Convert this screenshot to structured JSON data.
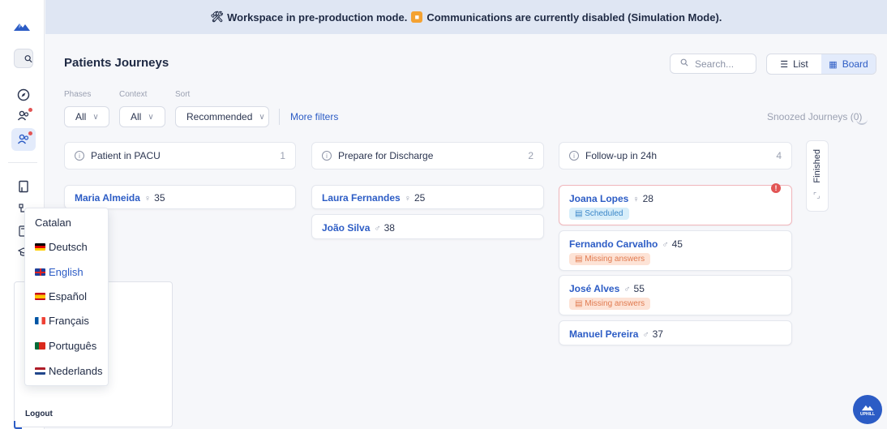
{
  "banner": {
    "prefix_icon": "✖",
    "text_before": "Workspace in pre-production mode.",
    "text_after": "Communications are currently disabled (Simulation Mode).",
    "warning_color": "#f4a232"
  },
  "header": {
    "title": "Patients Journeys",
    "search_placeholder": "Search...",
    "view_list": "List",
    "view_board": "Board"
  },
  "filters": {
    "phases_label": "Phases",
    "phases_value": "All",
    "context_label": "Context",
    "context_value": "All",
    "sort_label": "Sort",
    "sort_value": "Recommended",
    "more_filters": "More filters",
    "snoozed": "Snoozed Journeys (0)"
  },
  "columns": [
    {
      "title": "Patient in PACU",
      "count": "1",
      "cards": [
        {
          "name": "Maria Almeida",
          "sex": "♀",
          "age": "35"
        }
      ]
    },
    {
      "title": "Prepare for Discharge",
      "count": "2",
      "cards": [
        {
          "name": "Laura Fernandes",
          "sex": "♀",
          "age": "25"
        },
        {
          "name": "João Silva",
          "sex": "♂",
          "age": "38"
        }
      ]
    },
    {
      "title": "Follow-up in 24h",
      "count": "4",
      "cards": [
        {
          "name": "Joana Lopes",
          "sex": "♀",
          "age": "28",
          "tag": "Scheduled",
          "alert": "!"
        },
        {
          "name": "Fernando Carvalho",
          "sex": "♂",
          "age": "45",
          "tag": "Missing answers"
        },
        {
          "name": "José Alves",
          "sex": "♂",
          "age": "55",
          "tag": "Missing answers"
        },
        {
          "name": "Manuel Pereira",
          "sex": "♂",
          "age": "37"
        }
      ]
    }
  ],
  "finished_column": {
    "label": "Finished"
  },
  "languages": [
    {
      "label": "Catalan"
    },
    {
      "label": "Deutsch"
    },
    {
      "label": "English",
      "selected": true
    },
    {
      "label": "Español"
    },
    {
      "label": "Français"
    },
    {
      "label": "Português"
    },
    {
      "label": "Nederlands"
    }
  ],
  "profile": {
    "logout": "Logout"
  },
  "fab": {
    "label": "UPHILL"
  },
  "colors": {
    "accent": "#2c5cc5",
    "alert": "#e25555",
    "scheduled": "#3a86c8",
    "missing": "#e07a4f"
  }
}
